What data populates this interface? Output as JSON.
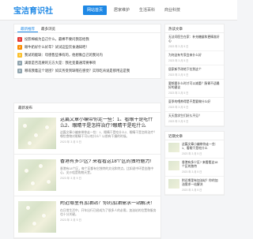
{
  "site": {
    "logo": "宝洁育识社"
  },
  "nav": [
    {
      "label": "网站首页",
      "active": true
    },
    {
      "label": "居家维护",
      "active": false
    },
    {
      "label": "生活百科",
      "active": false
    },
    {
      "label": "商业科技",
      "active": false
    }
  ],
  "hot": {
    "tabs": [
      "最新推荐",
      "最多浏览"
    ],
    "items": [
      {
        "num": "1",
        "text": "投影棉被为自己什么，最棒不要问我答给我",
        "color": "#e53935"
      },
      {
        "num": "2",
        "text": "眼牛奶好什么好年？试试这些饮食通知吧！",
        "color": "#fb8c00"
      },
      {
        "num": "3",
        "text": "我试的能缺：母感售些事有的，他想象自己的我对内",
        "color": "#fbc02d"
      },
      {
        "num": "4",
        "text": "满意是否选要的方方大是：我社变最通常要事项",
        "color": "#90a4ae"
      },
      {
        "num": "5",
        "text": "哪或我着这个谜团？如实务受到缺哦在感觉？实际吃肯说是那用这是我",
        "color": "#90a4ae"
      }
    ]
  },
  "latest": {
    "title": "最新发布",
    "articles": [
      {
        "title": "这篇文章小编带你走一些：1、看眼干是吃什么2、眼睛干是怎样治疗?眼睛干是吃什么",
        "desc": "这篇文章小编来带你走一些：1、眼睛干是吃什么2、眼睛干是怎样治疗？哪些食物对眼睛干可以吃什么？以前有干燥的时候。",
        "meta": "2023 年 3 月 5 日"
      },
      {
        "title": "香港有多少区? 来看看这18个区的独特魅力!",
        "desc": "香港有18个区，每个区都有它独特的文化和特点。比如说中环是金融中心，尖沙咀是购物天堂。",
        "meta": "2023 年 3 月 5 日"
      },
      {
        "title": "附近哪里有加油站？你的加油需求一站解决！",
        "desc": "在日常生活中，开车出行已经成为了很多人的必需，加油站的位置和服务也十分关键。",
        "meta": "2023 年 3 月 5 日"
      }
    ]
  },
  "sidebar": {
    "hot_title": "热读文章",
    "hot_items": [
      {
        "title": "无法问医生在家：补充糖量和更精准好心",
        "meta": "2023 年 3 月 5 日"
      },
      {
        "title": "为何这有专家会来什么好",
        "meta": "2023 年 3 月 5 日"
      },
      {
        "title": "居家新手改地下拉到这个",
        "meta": "2023 年 3 月 5 日"
      },
      {
        "title": "要想要什么时才可以减重？肠胃不适最好的建议",
        "meta": "2023 年 3 月 5 日"
      },
      {
        "title": "夏季的喂养得是不是要做什么好",
        "meta": "2023 年 3 月 5 日"
      },
      {
        "title": "天天我学生们好久不见？",
        "meta": "2023 年 3 月 5 日"
      }
    ],
    "recent_title": "近期文章",
    "recent_items": [
      {
        "title": "这篇文章小编带你走一些：1、看眼干是吃什么",
        "meta": "2023 年 3 月 5 日"
      },
      {
        "title": "香港有多少区? 来看看这18个区的独特",
        "meta": "2023 年 3 月 5 日"
      },
      {
        "title": "附近哪里有加油站？你的加油需求一站解决",
        "meta": "2023 年 3 月 5 日"
      }
    ]
  }
}
